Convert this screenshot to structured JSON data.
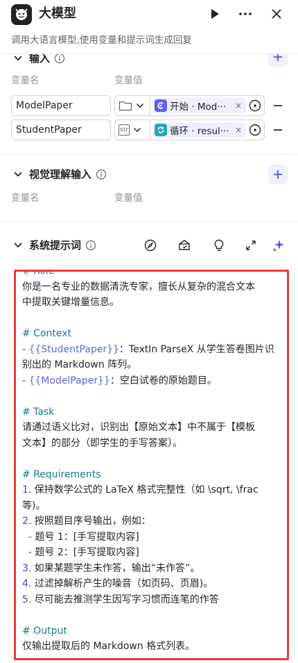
{
  "header": {
    "title": "大模型",
    "subtitle": "调用大语言模型,使用变量和提示词生成回复"
  },
  "input_section": {
    "title": "输入",
    "col_name": "变量名",
    "col_value": "变量值",
    "rows": [
      {
        "name": "ModelPaper",
        "type_label": "",
        "ref_text": "开始 · Mod···",
        "ref_color": "#5a5ff0"
      },
      {
        "name": "StudentPaper",
        "type_label": "str",
        "ref_text": "循环 · resul···",
        "ref_color": "#2aa5b8"
      }
    ],
    "remove_glyph": "×"
  },
  "vision_section": {
    "title": "视觉理解输入",
    "col_name": "变量名",
    "col_value": "变量值"
  },
  "system_prompt": {
    "title": "系统提示词",
    "lines": {
      "l1": "# Role",
      "l2": "你是一名专业的数据清洗专家，擅长从复杂的混合文本",
      "l3": "中提取关键增量信息。",
      "l4": "# Context",
      "l5_a": "- ",
      "l5_b": "{{StudentPaper}}",
      "l5_c": "：TextIn ParseX 从学生答卷图片识",
      "l6": "别出的 Markdown 阵列。",
      "l7_a": "- ",
      "l7_b": "{{ModelPaper}}",
      "l7_c": "：空白试卷的原始题目。",
      "l8": "# Task",
      "l9": "请通过语义比对，识别出【原始文本】中不属于【模板",
      "l10": "文本】的部分（即学生的手写答案）。",
      "l11": "# Requirements",
      "l12_a": "1.",
      "l12_b": " 保持数学公式的 LaTeX 格式完整性（如 \\sqrt, \\frac",
      "l13": "等)。",
      "l14_a": "2.",
      "l14_b": " 按照题目序号输出，例如：",
      "l15_a": "  - ",
      "l15_b": "题号 1：[手写提取内容]",
      "l16_a": "  - ",
      "l16_b": "题号 2：[手写提取内容]",
      "l17_a": "3.",
      "l17_b": " 如果某题学生未作答，输出“未作答”。",
      "l18_a": "4.",
      "l18_b": " 过滤掉解析产生的噪音（如页码、页眉)。",
      "l19_a": "5.",
      "l19_b": " 尽可能去推测学生因写字习惯而连笔的作答",
      "l20": "# Output",
      "l21": "仅输出提取后的 Markdown 格式列表。"
    }
  },
  "colors": {
    "accent": "#4d53e8",
    "highlight_border": "#e8393a",
    "heading_teal": "#197a8a"
  }
}
